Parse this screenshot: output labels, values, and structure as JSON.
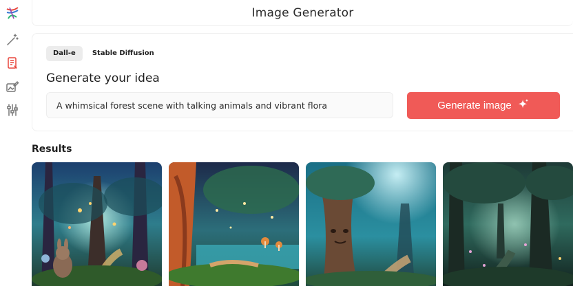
{
  "sidebar": {
    "items": [
      {
        "icon": "logo-icon"
      },
      {
        "icon": "magic-wand-icon"
      },
      {
        "icon": "document-icon",
        "active_color": "#e8453c"
      },
      {
        "icon": "image-edit-icon"
      },
      {
        "icon": "sliders-icon"
      }
    ]
  },
  "header": {
    "title": "Image Generator"
  },
  "generator": {
    "tabs": [
      {
        "label": "Dall-e",
        "active": true
      },
      {
        "label": "Stable Diffusion",
        "active": false
      }
    ],
    "heading": "Generate your idea",
    "prompt_value": "A whimsical forest scene with talking animals and vibrant flora",
    "generate_label": "Generate image",
    "generate_icon": "sparkle-icon",
    "accent_color": "#f05a57"
  },
  "results": {
    "title": "Results",
    "images": [
      {
        "name": "result-image-1"
      },
      {
        "name": "result-image-2"
      },
      {
        "name": "result-image-3"
      },
      {
        "name": "result-image-4"
      }
    ]
  }
}
